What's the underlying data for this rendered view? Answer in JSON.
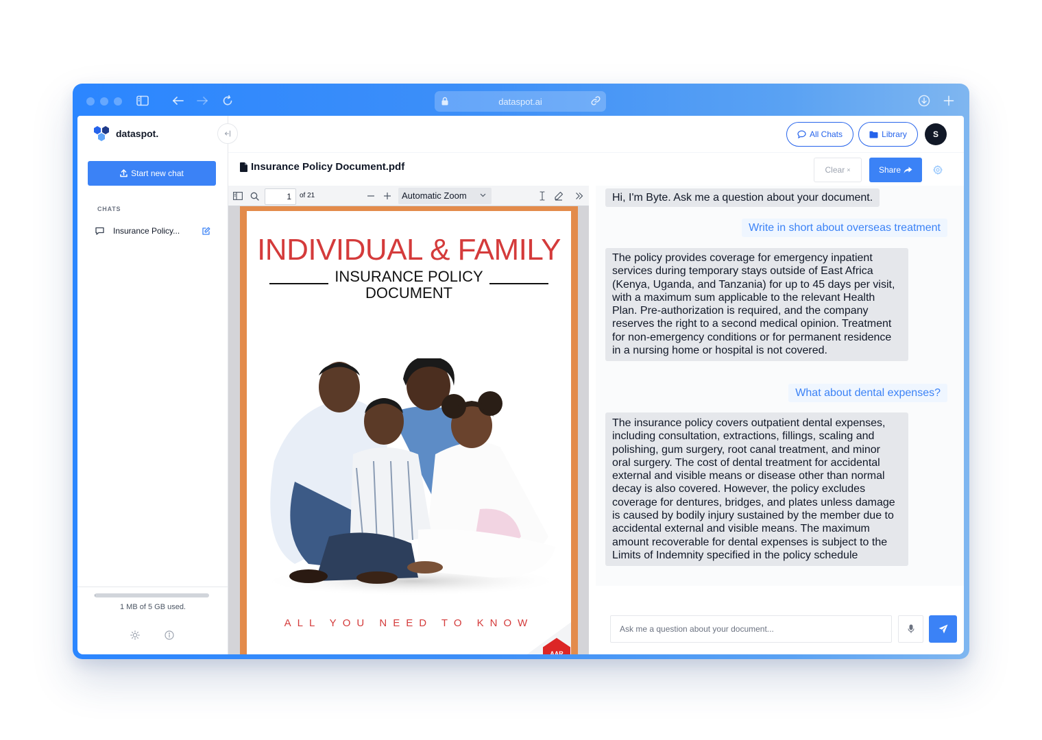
{
  "browser": {
    "url": "dataspot.ai",
    "icons": [
      "sidebar-toggle-icon",
      "back-arrow-icon",
      "forward-arrow-icon",
      "reload-icon",
      "lock-icon",
      "link-icon",
      "download-icon",
      "new-tab-plus-icon"
    ]
  },
  "app": {
    "name": "dataspot.",
    "accent_color": "#3b82f6"
  },
  "sidebar": {
    "new_chat_label": "Start new chat",
    "chats_heading": "CHATS",
    "chats": [
      {
        "label": "Insurance Policy..."
      }
    ],
    "storage": {
      "text": "1 MB of 5 GB used.",
      "fraction_used": 0.0002
    }
  },
  "header": {
    "all_chats_label": "All Chats",
    "library_label": "Library",
    "avatar_initial": "S"
  },
  "document": {
    "filename": "Insurance Policy Document.pdf",
    "clear_label": "Clear",
    "clear_x": "×",
    "share_label": "Share"
  },
  "pdf": {
    "page": "1",
    "page_count_label": "of 21",
    "zoom": "Automatic Zoom",
    "cover": {
      "title": "INDIVIDUAL & FAMILY",
      "subtitle_1": "INSURANCE POLICY",
      "subtitle_2": "DOCUMENT",
      "tagline": "ALL YOU NEED TO KNOW",
      "logo": "AAR"
    }
  },
  "chat": {
    "messages": [
      {
        "role": "bot",
        "text": "Hi, I'm Byte. Ask me a question about your document."
      },
      {
        "role": "user",
        "text": "Write in short about overseas treatment"
      },
      {
        "role": "bot",
        "text": "The policy provides coverage for emergency inpatient services during temporary stays outside of East Africa (Kenya, Uganda, and Tanzania) for up to 45 days per visit, with a maximum sum applicable to the relevant Health Plan. Pre-authorization is required, and the company reserves the right to a second medical opinion. Treatment for non-emergency conditions or for permanent residence in a nursing home or hospital is not covered."
      },
      {
        "role": "user",
        "text": "What about dental expenses?"
      },
      {
        "role": "bot",
        "text": "The insurance policy covers outpatient dental expenses, including consultation, extractions, fillings, scaling and polishing, gum surgery, root canal treatment, and minor oral surgery. The cost of dental treatment for accidental external and visible means or disease other than normal decay is also covered. However, the policy excludes coverage for dentures, bridges, and plates unless damage is caused by bodily injury sustained by the member due to accidental external and visible means. The maximum amount recoverable for dental expenses is subject to the Limits of Indemnity specified in the policy schedule"
      }
    ],
    "input_placeholder": "Ask me a question about your document..."
  }
}
